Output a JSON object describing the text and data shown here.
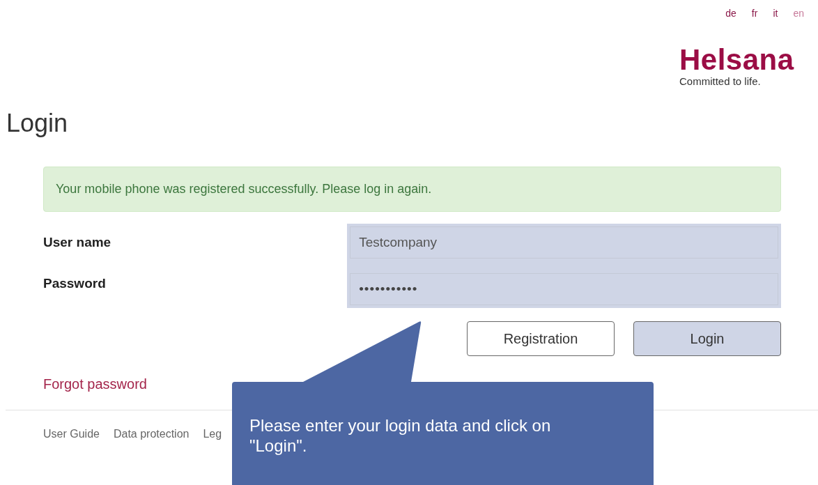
{
  "languages": [
    {
      "label": "de",
      "selected": false
    },
    {
      "label": "fr",
      "selected": false
    },
    {
      "label": "it",
      "selected": false
    },
    {
      "label": "en",
      "selected": true
    }
  ],
  "logo": {
    "name": "Helsana",
    "tagline": "Committed to life."
  },
  "title": "Login",
  "alert": "Your mobile phone was registered successfully. Please log in again.",
  "fields": [
    {
      "label": "User name",
      "value": "Testcompany",
      "kind": "text"
    },
    {
      "label": "Password",
      "value": "•••••••••••",
      "kind": "password"
    }
  ],
  "buttons": [
    {
      "label": "Registration",
      "kind": "secondary"
    },
    {
      "label": "Login",
      "kind": "primary"
    }
  ],
  "forgot_password": "Forgot password",
  "footer_links": [
    "User Guide",
    "Data protection",
    "Leg"
  ],
  "callout": {
    "text": "Please enter your login data and click on \"Login\"."
  }
}
